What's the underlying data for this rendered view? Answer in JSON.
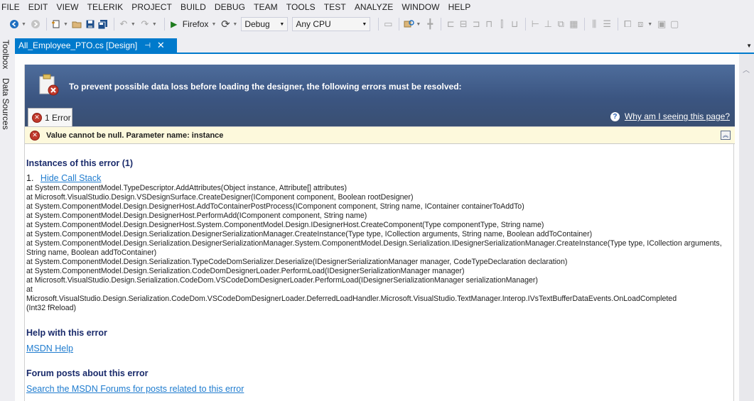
{
  "menu": [
    "FILE",
    "EDIT",
    "VIEW",
    "TELERIK",
    "PROJECT",
    "BUILD",
    "DEBUG",
    "TEAM",
    "TOOLS",
    "TEST",
    "ANALYZE",
    "WINDOW",
    "HELP"
  ],
  "toolbar": {
    "run_target": "Firefox",
    "configuration": "Debug",
    "platform": "Any CPU"
  },
  "side_tabs": [
    "Toolbox",
    "Data Sources"
  ],
  "document_tab": {
    "title": "All_Employee_PTO.cs [Design]",
    "pin_glyph": "⊣",
    "close_glyph": "✕"
  },
  "error_page": {
    "header_title": "To prevent possible data loss before loading the designer, the following errors must be resolved:",
    "tab_label": "1 Error",
    "why_link": "Why am I seeing this page?",
    "error_message": "Value cannot be null. Parameter name: instance",
    "instances_heading": "Instances of this error (1)",
    "instance_number": "1.",
    "hide_call_stack": "Hide Call Stack",
    "call_stack": [
      "at System.ComponentModel.TypeDescriptor.AddAttributes(Object instance, Attribute[] attributes)",
      "at Microsoft.VisualStudio.Design.VSDesignSurface.CreateDesigner(IComponent component, Boolean rootDesigner)",
      "at System.ComponentModel.Design.DesignerHost.AddToContainerPostProcess(IComponent component, String name, IContainer containerToAddTo)",
      "at System.ComponentModel.Design.DesignerHost.PerformAdd(IComponent component, String name)",
      "at System.ComponentModel.Design.DesignerHost.System.ComponentModel.Design.IDesignerHost.CreateComponent(Type componentType, String name)",
      "at System.ComponentModel.Design.Serialization.DesignerSerializationManager.CreateInstance(Type type, ICollection arguments, String name, Boolean addToContainer)",
      "at System.ComponentModel.Design.Serialization.DesignerSerializationManager.System.ComponentModel.Design.Serialization.IDesignerSerializationManager.CreateInstance(Type type, ICollection arguments, String name, Boolean addToContainer)",
      "at System.ComponentModel.Design.Serialization.TypeCodeDomSerializer.Deserialize(IDesignerSerializationManager manager, CodeTypeDeclaration declaration)",
      "at System.ComponentModel.Design.Serialization.CodeDomDesignerLoader.PerformLoad(IDesignerSerializationManager manager)",
      "at Microsoft.VisualStudio.Design.Serialization.CodeDom.VSCodeDomDesignerLoader.PerformLoad(IDesignerSerializationManager serializationManager)",
      "at",
      "Microsoft.VisualStudio.Design.Serialization.CodeDom.VSCodeDomDesignerLoader.DeferredLoadHandler.Microsoft.VisualStudio.TextManager.Interop.IVsTextBufferDataEvents.OnLoadCompleted",
      "(Int32 fReload)"
    ],
    "help_heading": "Help with this error",
    "msdn_help": "MSDN Help",
    "forum_heading": "Forum posts about this error",
    "forum_link": "Search the MSDN Forums for posts related to this error"
  }
}
